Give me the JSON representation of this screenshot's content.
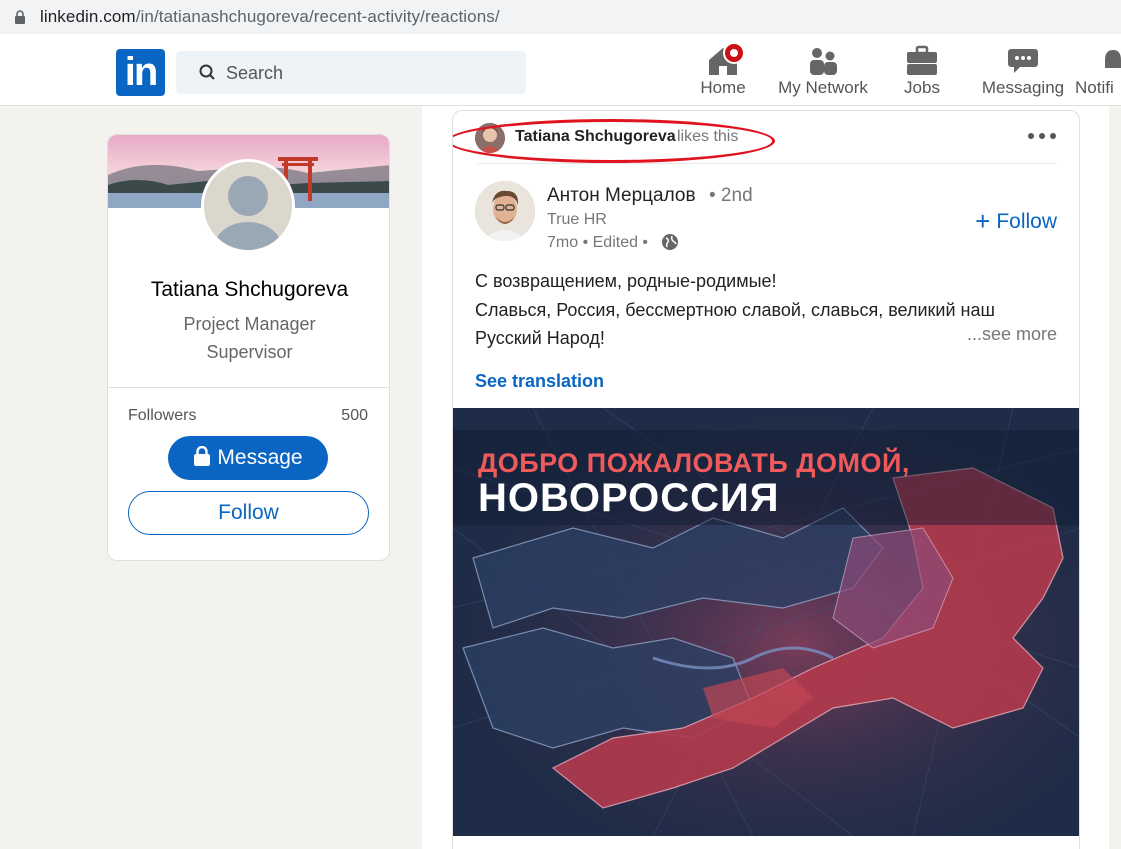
{
  "browser": {
    "url_domain": "linkedin.com",
    "url_path": "/in/tatianashchugoreva/recent-activity/reactions/"
  },
  "nav": {
    "logo_text": "in",
    "search_placeholder": "Search",
    "items": [
      {
        "label": "Home",
        "icon": "home-icon"
      },
      {
        "label": "My Network",
        "icon": "network-icon"
      },
      {
        "label": "Jobs",
        "icon": "briefcase-icon"
      },
      {
        "label": "Messaging",
        "icon": "messaging-icon"
      },
      {
        "label": "Notifi",
        "icon": "bell-icon"
      }
    ]
  },
  "profile": {
    "name": "Tatiana Shchugoreva",
    "headline": "Project Manager Supervisor",
    "followers_label": "Followers",
    "followers_count": "500",
    "message_label": "Message",
    "follow_label": "Follow"
  },
  "post": {
    "activity_actor": "Tatiana Shchugoreva",
    "activity_suffix": "likes this",
    "author_name": "Антон Мерцалов",
    "author_degree": "• 2nd",
    "author_title": "True HR",
    "author_meta": "7mo • Edited •",
    "follow_label": "Follow",
    "text_line1": "С возвращением, родные-родимые!",
    "text_line2": "Славься, Россия, бессмертною славой, славься, великий наш",
    "text_line3": "Русский Народ!",
    "see_more": "...see more",
    "see_translation": "See translation",
    "image_title_line1": "ДОБРО ПОЖАЛОВАТЬ ДОМОЙ,",
    "image_title_line2": "НОВОРОССИЯ"
  },
  "colors": {
    "linkedin_blue": "#0a66c2",
    "highlight_red": "#e0141e",
    "page_bg": "#f3f2ef"
  }
}
